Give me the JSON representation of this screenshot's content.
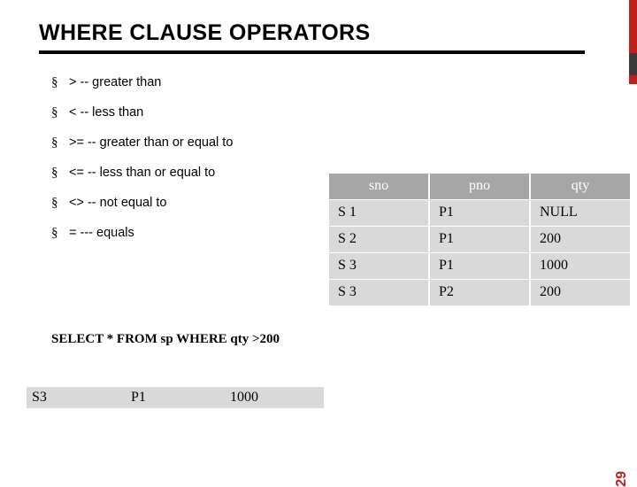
{
  "slide": {
    "title": "WHERE CLAUSE OPERATORS",
    "page_number": "29",
    "accent_color": "#c0201b",
    "header_color": "#a6a6a6",
    "cell_color": "#d9d9d9"
  },
  "bullets": [
    {
      "marker": "§",
      "text": "> -- greater than"
    },
    {
      "marker": "§",
      "text": "< -- less than"
    },
    {
      "marker": "§",
      "text": ">= -- greater than or equal to"
    },
    {
      "marker": "§",
      "text": "<= -- less than or equal to"
    },
    {
      "marker": "§",
      "text": "<> -- not equal to"
    },
    {
      "marker": "§",
      "text": "= --- equals"
    }
  ],
  "sp_table": {
    "columns": [
      "sno",
      "pno",
      "qty"
    ],
    "rows": [
      [
        "S 1",
        "P1",
        "NULL"
      ],
      [
        "S 2",
        "P1",
        "200"
      ],
      [
        "S 3",
        "P1",
        "1000"
      ],
      [
        "S 3",
        "P2",
        "200"
      ]
    ]
  },
  "query": "SELECT * FROM sp WHERE qty >200",
  "result_row": [
    "S3",
    "P1",
    "1000"
  ]
}
